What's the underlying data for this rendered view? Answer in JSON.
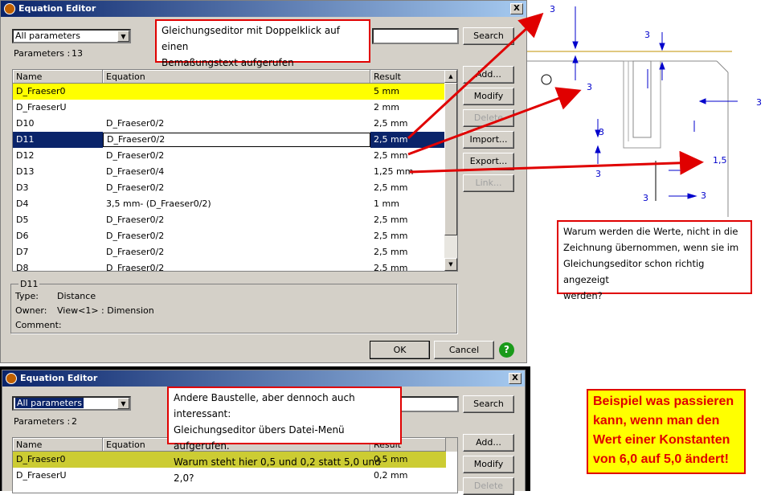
{
  "top_dialog": {
    "title": "Equation Editor",
    "close_label": "X",
    "filter_value": "All parameters",
    "params_label": "Parameters :",
    "params_count": "13",
    "search_label": "Search",
    "columns": [
      "Name",
      "Equation",
      "Result"
    ],
    "rows": [
      {
        "name": "D_Fraeser0",
        "equation": "",
        "result": "5 mm"
      },
      {
        "name": "D_FraeserU",
        "equation": "",
        "result": "2 mm"
      },
      {
        "name": "D10",
        "equation": "D_Fraeser0/2",
        "result": "2,5 mm"
      },
      {
        "name": "D11",
        "equation": "D_Fraeser0/2",
        "result": "2,5 mm"
      },
      {
        "name": "D12",
        "equation": "D_Fraeser0/2",
        "result": "2,5 mm"
      },
      {
        "name": "D13",
        "equation": "D_Fraeser0/4",
        "result": "1,25 mm"
      },
      {
        "name": "D3",
        "equation": "D_Fraeser0/2",
        "result": "2,5 mm"
      },
      {
        "name": "D4",
        "equation": "3,5  mm- (D_Fraeser0/2)",
        "result": "1 mm"
      },
      {
        "name": "D5",
        "equation": "D_Fraeser0/2",
        "result": "2,5 mm"
      },
      {
        "name": "D6",
        "equation": "D_Fraeser0/2",
        "result": "2,5 mm"
      },
      {
        "name": "D7",
        "equation": "D_Fraeser0/2",
        "result": "2,5 mm"
      },
      {
        "name": "D8",
        "equation": "D_Fraeser0/2",
        "result": "2,5 mm"
      }
    ],
    "buttons": {
      "add": "Add...",
      "modify": "Modify",
      "delete": "Delete",
      "import": "Import...",
      "export": "Export...",
      "link": "Link..."
    },
    "details": {
      "legend": "D11",
      "type_label": "Type:",
      "type_value": "Distance",
      "owner_label": "Owner:",
      "owner_value": "View<1> : Dimension",
      "comment_label": "Comment:"
    },
    "ok_label": "OK",
    "cancel_label": "Cancel",
    "help_label": "?"
  },
  "bottom_dialog": {
    "title": "Equation Editor",
    "close_label": "X",
    "filter_value": "All parameters",
    "params_label": "Parameters :",
    "params_count": "2",
    "search_label": "Search",
    "columns": [
      "Name",
      "Equation",
      "Result"
    ],
    "rows": [
      {
        "name": "D_Fraeser0",
        "equation": "",
        "result": "0,5 mm"
      },
      {
        "name": "D_FraeserU",
        "equation": "",
        "result": "0,2 mm"
      }
    ],
    "buttons": {
      "add": "Add...",
      "modify": "Modify",
      "delete": "Delete"
    }
  },
  "callouts": {
    "top": [
      "Gleichungseditor mit Doppelklick auf einen",
      "Bemaßungstext aufgerufen"
    ],
    "middle": [
      "Andere Baustelle, aber dennoch auch interessant:",
      "Gleichungseditor übers Datei-Menü aufgerufen.",
      "Warum steht hier 0,5 und 0,2 statt 5,0 und 2,0?"
    ],
    "right": [
      "Warum werden die Werte, nicht in die",
      "Zeichnung übernommen, wenn sie im",
      "Gleichungseditor schon richtig angezeigt",
      "werden?"
    ],
    "yellow": [
      "Beispiel was passieren",
      "kann, wenn man den",
      "Wert einer Konstanten",
      "von 6,0 auf 5,0 ändert!"
    ]
  },
  "drawing_dims": [
    "3",
    "3",
    "3",
    "3",
    "3",
    "3",
    "3",
    "1,5",
    "3"
  ],
  "colors": {
    "title_blue": "#0a246a",
    "selection": "#0a246a",
    "highlight": "#ffff00",
    "arrow_red": "#e00000",
    "dim_blue": "#0000cc"
  }
}
